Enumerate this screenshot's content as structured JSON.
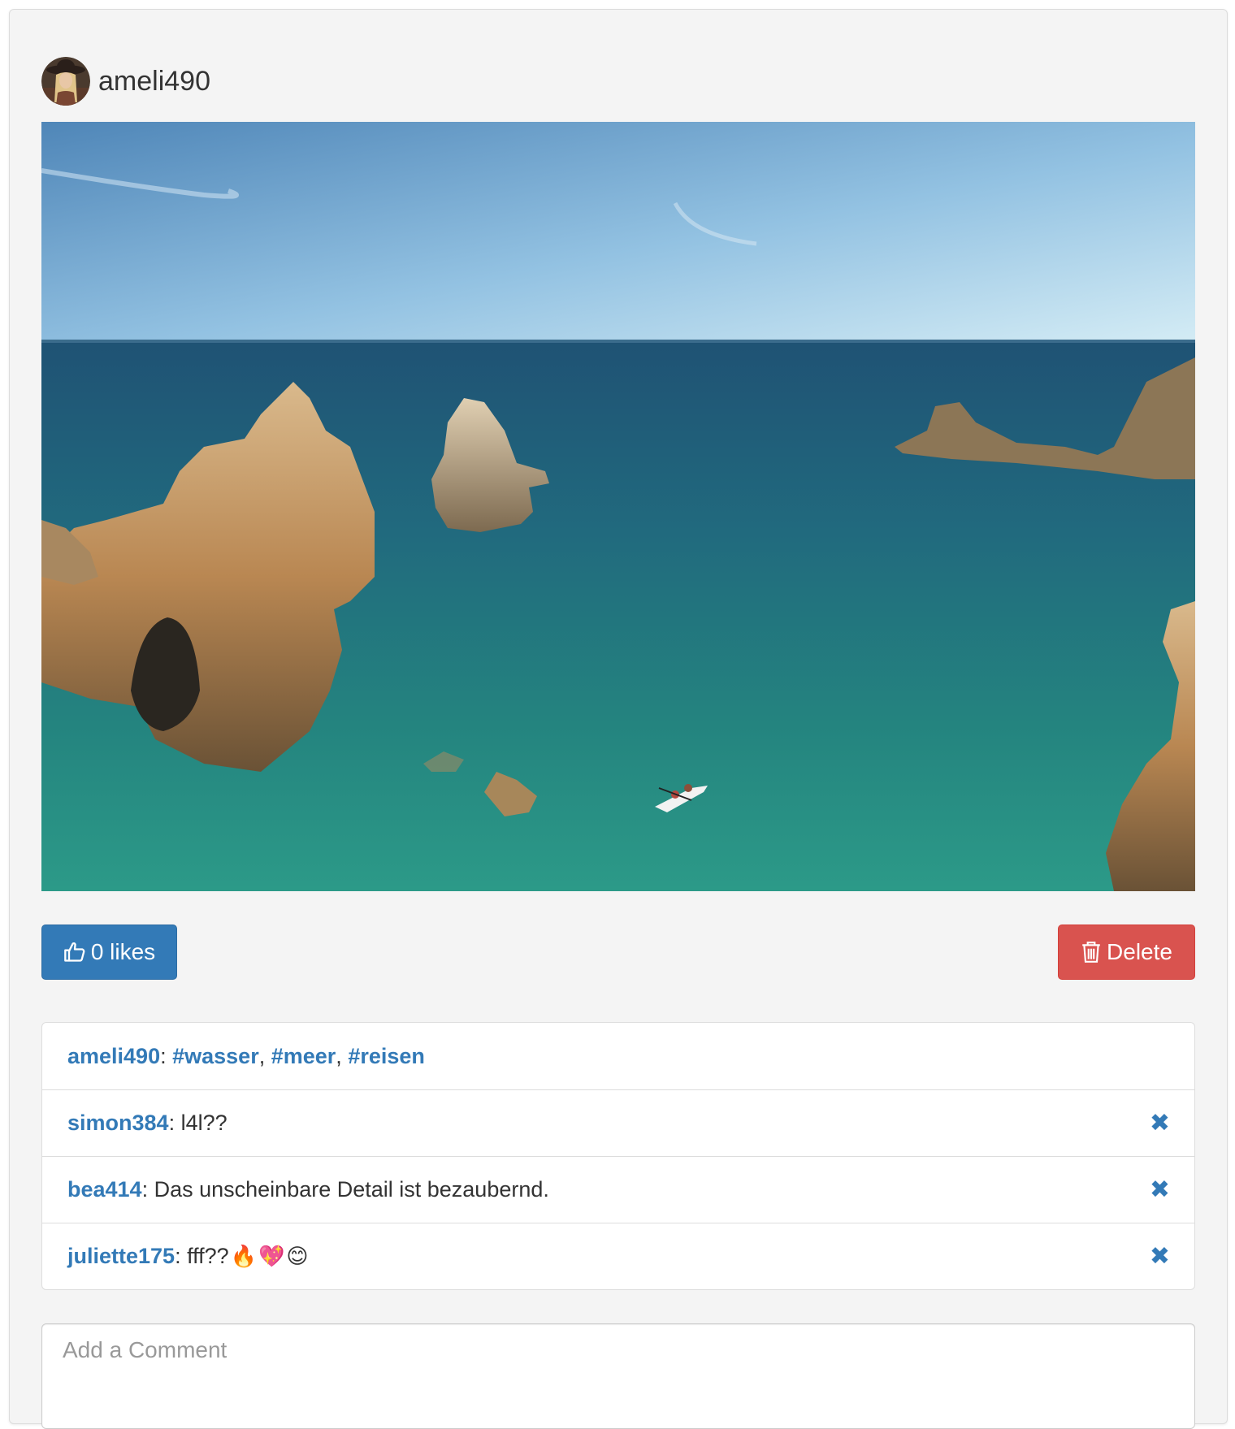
{
  "post": {
    "author": "ameli490",
    "likes_label": "0 likes",
    "delete_label": "Delete"
  },
  "comments": [
    {
      "user": "ameli490",
      "tags": [
        "#wasser",
        "#meer",
        "#reisen"
      ]
    },
    {
      "user": "simon384",
      "text": "l4l??",
      "removable": true
    },
    {
      "user": "bea414",
      "text": "Das unscheinbare Detail ist bezaubernd.",
      "removable": true
    },
    {
      "user": "juliette175",
      "text": "fff??",
      "emojis": [
        "🔥",
        "💖",
        "😊"
      ],
      "removable": true
    }
  ],
  "icons": {
    "like": "thumbs-up-icon",
    "delete": "trash-icon",
    "remove": "close-icon",
    "remove_glyph": "✖"
  },
  "comment_input": {
    "placeholder": "Add a Comment"
  },
  "colors": {
    "link": "#337ab7",
    "primary_button": "#337ab7",
    "danger_button": "#d9534f",
    "card_background": "#f4f4f4"
  }
}
